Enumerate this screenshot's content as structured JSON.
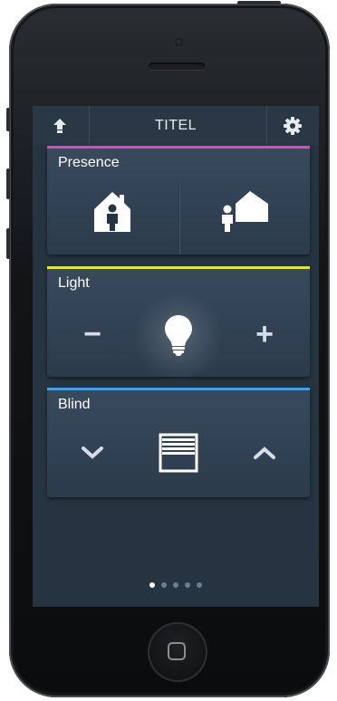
{
  "header": {
    "title": "TITEL",
    "back_icon": "up-arrow-icon",
    "settings_icon": "gear-icon"
  },
  "cards": {
    "presence": {
      "label": "Presence",
      "accent": "#e048b6",
      "home_icon": "person-at-home-icon",
      "away_icon": "person-away-icon"
    },
    "light": {
      "label": "Light",
      "accent": "#e8e04a",
      "decrease_label": "−",
      "increase_label": "+",
      "bulb_icon": "lightbulb-icon"
    },
    "blind": {
      "label": "Blind",
      "accent": "#4b9fe0",
      "down_icon": "chevron-down-icon",
      "up_icon": "chevron-up-icon",
      "blind_icon": "window-blind-icon"
    }
  },
  "pager": {
    "total": 5,
    "active": 1
  },
  "colors": {
    "screen_bg": "#263341",
    "card_bg": "#36475a"
  }
}
